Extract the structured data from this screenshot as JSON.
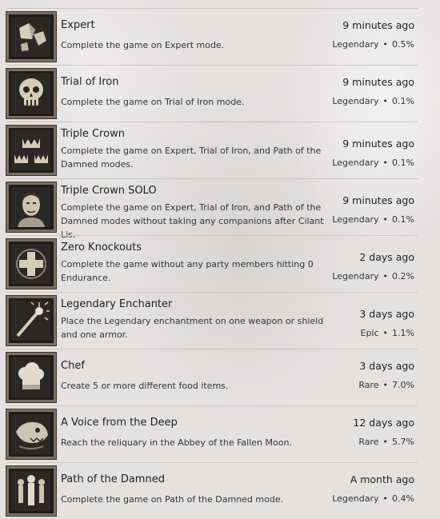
{
  "achievements": [
    {
      "title": "Expert",
      "description": "Complete the game on Expert mode.",
      "time": "9 minutes ago",
      "rarity": "Legendary",
      "percent": "0.5%",
      "icon": "dice-icon"
    },
    {
      "title": "Trial of Iron",
      "description": "Complete the game on Trial of Iron mode.",
      "time": "9 minutes ago",
      "rarity": "Legendary",
      "percent": "0.1%",
      "icon": "skull-icon"
    },
    {
      "title": "Triple Crown",
      "description": "Complete the game on Expert, Trial of Iron, and Path of the Damned modes.",
      "time": "9 minutes ago",
      "rarity": "Legendary",
      "percent": "0.1%",
      "icon": "crowns-icon"
    },
    {
      "title": "Triple Crown SOLO",
      "description": "Complete the game on Expert, Trial of Iron, and Path of the Damned modes without taking any companions after Cilant Lis.",
      "time": "9 minutes ago",
      "rarity": "Legendary",
      "percent": "0.1%",
      "icon": "portrait-icon"
    },
    {
      "title": "Zero Knockouts",
      "description": "Complete the game without any party members hitting 0 Endurance.",
      "time": "2 days ago",
      "rarity": "Legendary",
      "percent": "0.2%",
      "icon": "cross-icon"
    },
    {
      "title": "Legendary Enchanter",
      "description": "Place the Legendary enchantment on one weapon or shield and one armor.",
      "time": "3 days ago",
      "rarity": "Epic",
      "percent": "1.1%",
      "icon": "wand-icon"
    },
    {
      "title": "Chef",
      "description": "Create 5 or more different food items.",
      "time": "3 days ago",
      "rarity": "Rare",
      "percent": "7.0%",
      "icon": "chef-hat-icon"
    },
    {
      "title": "A Voice from the Deep",
      "description": "Reach the reliquary in the Abbey of the Fallen Moon.",
      "time": "12 days ago",
      "rarity": "Rare",
      "percent": "5.7%",
      "icon": "beast-icon"
    },
    {
      "title": "Path of the Damned",
      "description": "Complete the game on Path of the Damned mode.",
      "time": "A month ago",
      "rarity": "Legendary",
      "percent": "0.4%",
      "icon": "figures-icon"
    }
  ],
  "separator": "•"
}
